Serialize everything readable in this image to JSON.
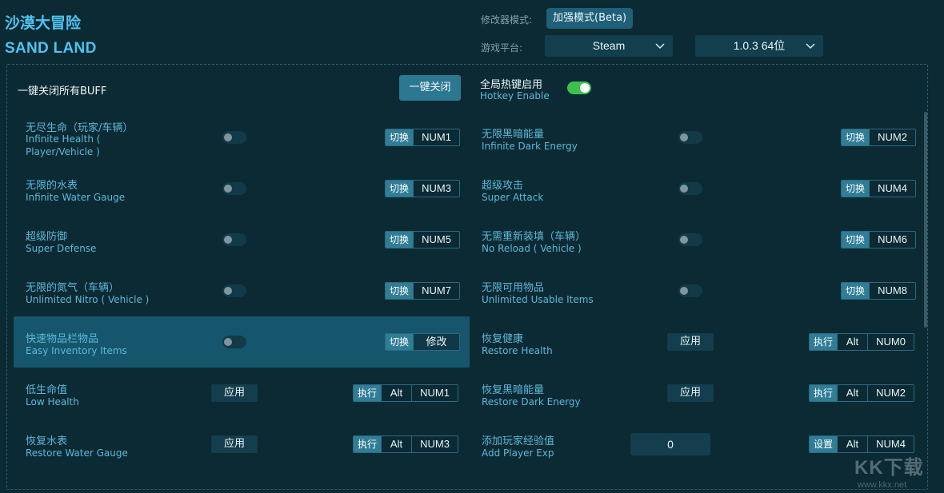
{
  "app": {
    "title_cn": "沙漠大冒险",
    "title_en": "SAND LAND"
  },
  "header": {
    "mode_label": "修改器模式:",
    "mode_value": "加强模式(Beta)",
    "platform_label": "游戏平台:",
    "platform_value": "Steam",
    "version_value": "1.0.3 64位"
  },
  "top": {
    "close_all_label": "一键关闭所有BUFF",
    "close_all_button": "一键关闭",
    "hotkey_cn": "全局热键启用",
    "hotkey_en": "Hotkey Enable",
    "hotkey_enabled": true
  },
  "cheats": [
    {
      "cn": "无尽生命（玩家/车辆）",
      "en1": "Infinite Health (",
      "en2": "Player/Vehicle )",
      "action": "切换",
      "keys": [
        "NUM1"
      ],
      "on": false
    },
    {
      "cn": "无限黑暗能量",
      "en1": "Infinite Dark Energy",
      "action": "切换",
      "keys": [
        "NUM2"
      ],
      "on": false
    },
    {
      "cn": "无限的水表",
      "en1": "Infinite Water Gauge",
      "action": "切换",
      "keys": [
        "NUM3"
      ],
      "on": false
    },
    {
      "cn": "超级攻击",
      "en1": "Super Attack",
      "action": "切换",
      "keys": [
        "NUM4"
      ],
      "on": false
    },
    {
      "cn": "超级防御",
      "en1": "Super Defense",
      "action": "切换",
      "keys": [
        "NUM5"
      ],
      "on": false
    },
    {
      "cn": "无需重新装填（车辆）",
      "en1": "No Reload ( Vehicle )",
      "action": "切换",
      "keys": [
        "NUM6"
      ],
      "on": false
    },
    {
      "cn": "无限的氮气（车辆）",
      "en1": "Unlimited Nitro ( Vehicle )",
      "action": "切换",
      "keys": [
        "NUM7"
      ],
      "on": false
    },
    {
      "cn": "无限可用物品",
      "en1": "Unlimited Usable Items",
      "action": "切换",
      "keys": [
        "NUM8"
      ],
      "on": false
    },
    {
      "cn": "快速物品栏物品",
      "en1": "Easy Inventory Items",
      "action": "切换",
      "keys": [
        "修改"
      ],
      "on": false
    },
    {
      "cn": "恢复健康",
      "en1": "Restore Health",
      "apply": "应用",
      "action": "执行",
      "keys": [
        "Alt",
        "NUM0"
      ]
    },
    {
      "cn": "低生命值",
      "en1": "Low Health",
      "apply": "应用",
      "action": "执行",
      "keys": [
        "Alt",
        "NUM1"
      ]
    },
    {
      "cn": "恢复黑暗能量",
      "en1": "Restore Dark Energy",
      "apply": "应用",
      "action": "执行",
      "keys": [
        "Alt",
        "NUM2"
      ]
    },
    {
      "cn": "恢复水表",
      "en1": "Restore Water Gauge",
      "apply": "应用",
      "action": "执行",
      "keys": [
        "Alt",
        "NUM3"
      ]
    },
    {
      "cn": "添加玩家经验值",
      "en1": "Add Player Exp",
      "input_value": "0",
      "action": "设置",
      "keys": [
        "Alt",
        "NUM4"
      ]
    }
  ],
  "watermark": {
    "text": "KK下载",
    "sub": "www.kkx.net"
  }
}
